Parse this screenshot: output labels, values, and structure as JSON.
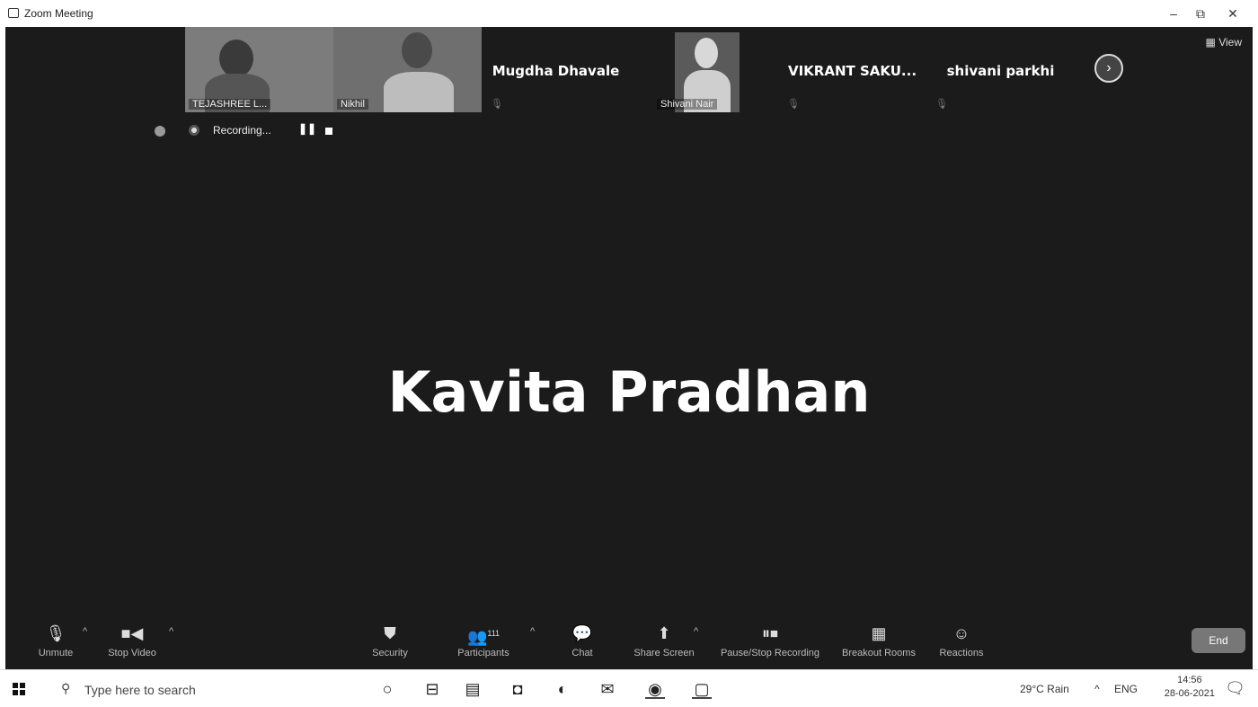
{
  "window": {
    "title": "Zoom Meeting",
    "min_glyph": "–",
    "restore_glyph": "⧉",
    "close_glyph": "✕"
  },
  "thumbnails": [
    {
      "name": "TEJASHREE L...",
      "video": true
    },
    {
      "name": "Nikhil",
      "video": true
    },
    {
      "name": "Mugdha Dhavale",
      "video": false
    },
    {
      "name": "Shivani Nair",
      "video": true
    },
    {
      "name": "VIKRANT SAKU...",
      "video": false
    },
    {
      "name": "shivani parkhi",
      "video": false
    }
  ],
  "view_label": "View",
  "recording": {
    "label": "Recording..."
  },
  "active_speaker": "Kavita Pradhan",
  "controls": {
    "unmute": "Unmute",
    "stop_video": "Stop Video",
    "security": "Security",
    "participants": "Participants",
    "participants_count": "111",
    "chat": "Chat",
    "share_screen": "Share Screen",
    "pause_stop_recording": "Pause/Stop Recording",
    "breakout_rooms": "Breakout Rooms",
    "reactions": "Reactions",
    "end": "End"
  },
  "taskbar": {
    "search_placeholder": "Type here to search",
    "weather": "29°C Rain",
    "lang": "ENG",
    "time": "14:56",
    "date": "28-06-2021"
  }
}
